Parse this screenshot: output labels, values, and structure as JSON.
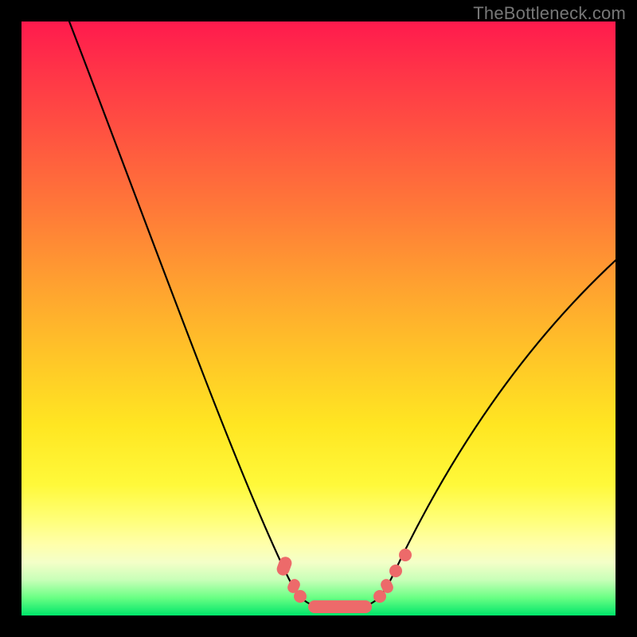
{
  "watermark": "TheBottleneck.com",
  "chart_data": {
    "type": "line",
    "title": "",
    "xlabel": "",
    "ylabel": "",
    "ylim": [
      0,
      100
    ],
    "x": [
      0,
      5,
      10,
      15,
      20,
      25,
      30,
      35,
      40,
      42,
      44,
      46,
      48,
      50,
      52,
      54,
      56,
      58,
      60,
      65,
      70,
      75,
      80,
      85,
      90,
      95,
      100
    ],
    "series": [
      {
        "name": "bottleneck",
        "values": [
          100,
          90,
          80,
          70,
          60,
          50,
          40,
          30,
          20,
          12,
          6,
          3,
          1,
          0,
          0,
          1,
          3,
          6,
          12,
          22,
          30,
          37,
          43,
          48,
          52,
          56,
          60
        ]
      }
    ],
    "markers": [
      {
        "x": 42,
        "y": 12
      },
      {
        "x": 44,
        "y": 6
      },
      {
        "x": 45,
        "y": 3
      },
      {
        "x": 47,
        "y": 0
      },
      {
        "x": 50,
        "y": 0
      },
      {
        "x": 53,
        "y": 0
      },
      {
        "x": 55,
        "y": 1
      },
      {
        "x": 56,
        "y": 3
      },
      {
        "x": 58,
        "y": 6
      },
      {
        "x": 60,
        "y": 12
      }
    ],
    "colors": {
      "line": "#000000",
      "marker": "#ed6a6a",
      "gradient_top": "#ff1a4d",
      "gradient_bottom": "#00e56a"
    }
  }
}
